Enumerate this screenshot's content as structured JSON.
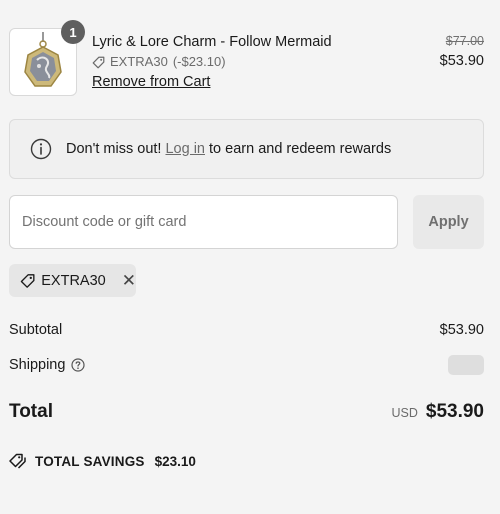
{
  "item": {
    "quantity": "1",
    "title": "Lyric & Lore Charm - Follow Mermaid",
    "discount_code": "EXTRA30",
    "discount_amount": "(-$23.10)",
    "remove_label": "Remove from Cart",
    "compare_at_price": "$77.00",
    "price": "$53.90",
    "thumbnail_icon": "charm-pendant-image"
  },
  "rewards": {
    "icon": "info-icon",
    "prefix": "Don't miss out!",
    "link": "Log in",
    "suffix": "to earn and redeem rewards"
  },
  "discount": {
    "placeholder": "Discount code or gift card",
    "value": "",
    "apply_label": "Apply"
  },
  "applied_code": {
    "code": "EXTRA30",
    "remove_symbol": "✕"
  },
  "summary": {
    "subtotal_label": "Subtotal",
    "subtotal_value": "$53.90",
    "shipping_label": "Shipping",
    "total_label": "Total",
    "currency": "USD",
    "total_value": "$53.90",
    "savings_label": "TOTAL SAVINGS",
    "savings_value": "$23.10"
  },
  "colors": {
    "background": "#f4f4f4",
    "badge": "#5f5f5f",
    "chip": "#e6e6e6",
    "button": "#e9e9e9"
  }
}
